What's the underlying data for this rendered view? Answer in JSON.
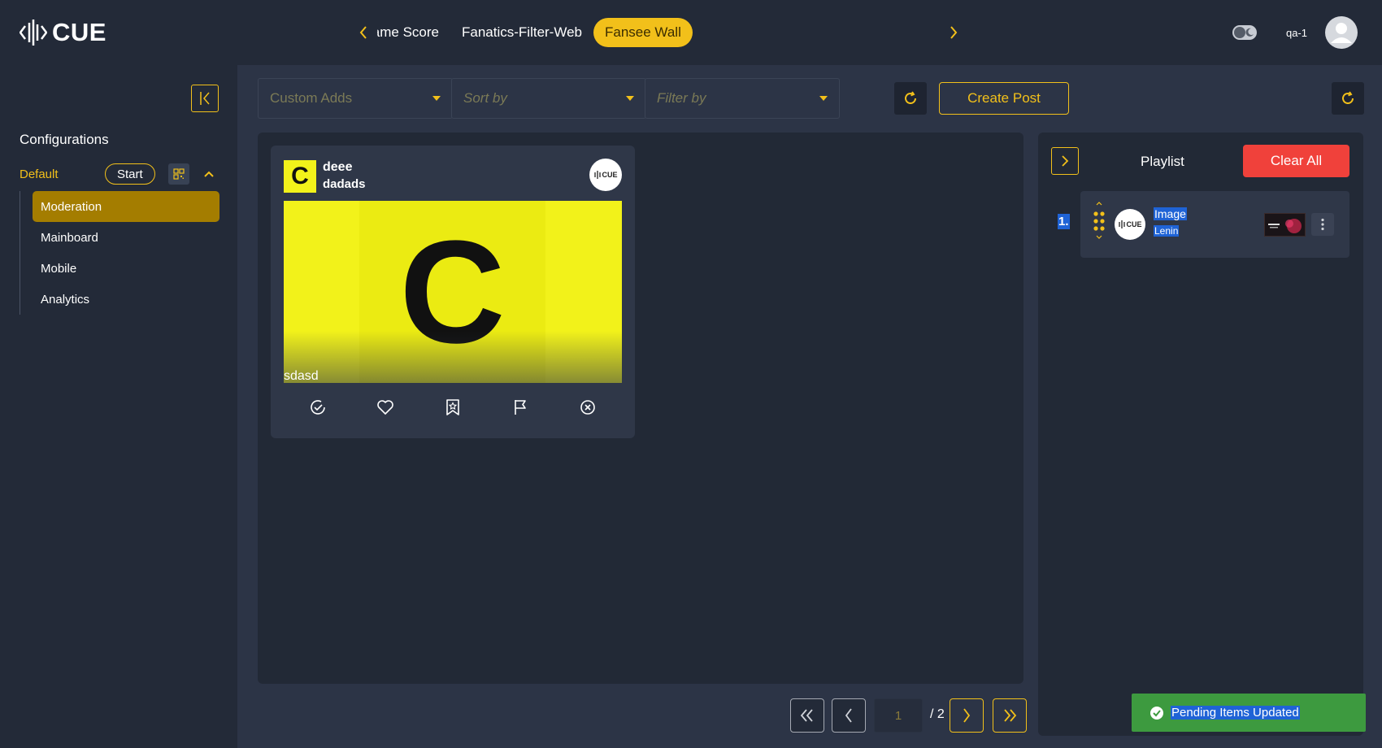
{
  "header": {
    "logo_text": "CUE",
    "tabs": [
      {
        "label": "Game Score",
        "active": false
      },
      {
        "label": "Fanatics-Filter-Web",
        "active": false
      },
      {
        "label": "Fansee Wall",
        "active": true
      }
    ],
    "user_name": "qa-1"
  },
  "sidebar": {
    "title": "Configurations",
    "config_name": "Default",
    "start_label": "Start",
    "items": [
      {
        "label": "Moderation",
        "active": true
      },
      {
        "label": "Mainboard",
        "active": false
      },
      {
        "label": "Mobile",
        "active": false
      },
      {
        "label": "Analytics",
        "active": false
      }
    ]
  },
  "toolbar": {
    "custom_adds_placeholder": "Custom Adds",
    "sort_placeholder": "Sort by",
    "filter_placeholder": "Filter by",
    "create_post_label": "Create Post"
  },
  "post": {
    "avatar_letter": "C",
    "name": "deee",
    "handle": "dadads",
    "badge_text": "CUE",
    "media_letter": "C",
    "caption": "sdasd"
  },
  "pagination": {
    "current_page": "1",
    "total_label": "/ 2"
  },
  "playlist": {
    "title": "Playlist",
    "clear_all_label": "Clear All",
    "items": [
      {
        "index": "1.",
        "name": "Image",
        "owner": "Lenin",
        "badge_text": "CUE"
      }
    ]
  },
  "toast": {
    "message": "Pending Items Updated"
  },
  "colors": {
    "accent": "#f2c01a",
    "danger": "#f0413b",
    "success": "#3d9a3f",
    "background": "#232a38",
    "panel": "#2c3446"
  }
}
